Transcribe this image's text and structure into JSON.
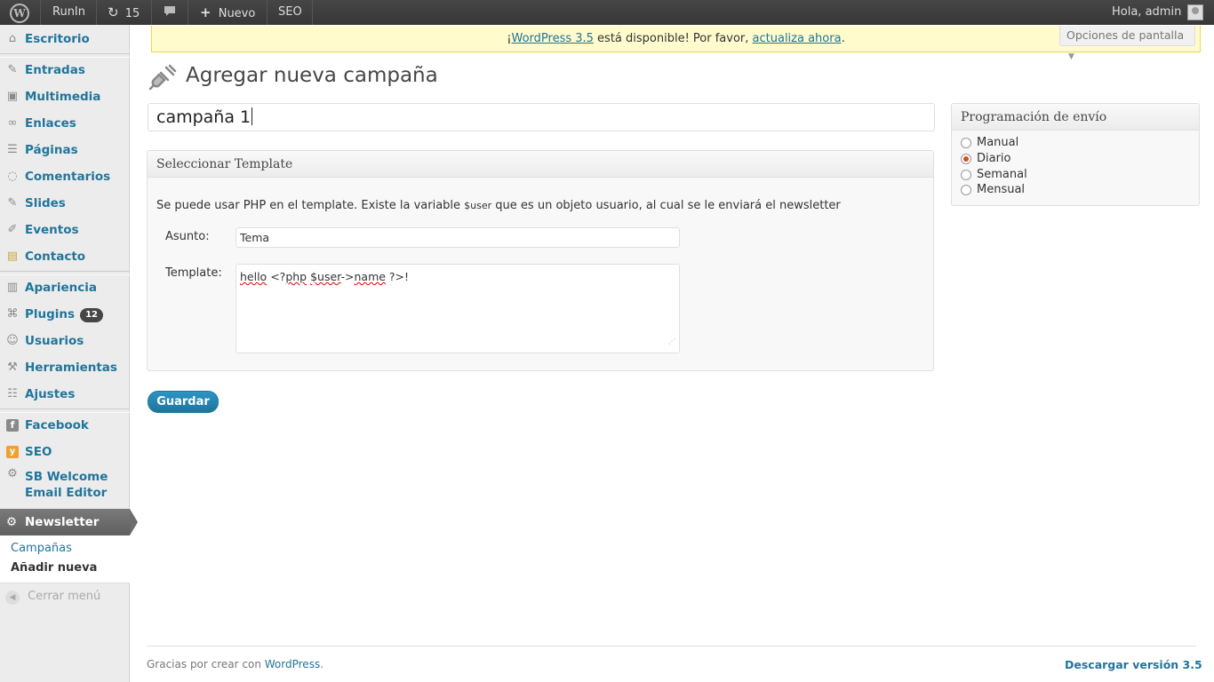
{
  "adminbar": {
    "site_name": "RunIn",
    "updates_count": "15",
    "new_label": "Nuevo",
    "seo_label": "SEO",
    "greeting": "Hola, admin"
  },
  "sidebar": {
    "items": [
      {
        "label": "Escritorio",
        "icon": "home-icon"
      },
      {
        "label": "Entradas",
        "icon": "pin-icon"
      },
      {
        "label": "Multimedia",
        "icon": "media-icon"
      },
      {
        "label": "Enlaces",
        "icon": "link-icon"
      },
      {
        "label": "Páginas",
        "icon": "pages-icon"
      },
      {
        "label": "Comentarios",
        "icon": "comment-icon"
      },
      {
        "label": "Slides",
        "icon": "pin-icon"
      },
      {
        "label": "Eventos",
        "icon": "events-icon"
      },
      {
        "label": "Contacto",
        "icon": "contact-icon"
      },
      {
        "label": "Apariencia",
        "icon": "appearance-icon"
      },
      {
        "label": "Plugins",
        "icon": "plugin-icon",
        "badge": "12"
      },
      {
        "label": "Usuarios",
        "icon": "users-icon"
      },
      {
        "label": "Herramientas",
        "icon": "tools-icon"
      },
      {
        "label": "Ajustes",
        "icon": "settings-icon"
      },
      {
        "label": "Facebook",
        "icon": "facebook-icon"
      },
      {
        "label": "SEO",
        "icon": "seo-icon"
      },
      {
        "label": "SB Welcome",
        "label2": "Email Editor",
        "icon": "gear-icon"
      },
      {
        "label": "Newsletter",
        "icon": "gear-icon"
      }
    ],
    "submenu": [
      "Campañas",
      "Añadir nueva"
    ],
    "collapse_label": "Cerrar menú"
  },
  "notice": {
    "prefix": "¡",
    "link1": "WordPress 3.5",
    "middle": " está disponible! Por favor, ",
    "link2": "actualiza ahora",
    "suffix": "."
  },
  "screen_options_label": "Opciones de pantalla",
  "page_title": "Agregar nueva campaña",
  "campaign_title_value": "campaña 1",
  "template_box": {
    "title": "Seleccionar Template",
    "description_before": "Se puede usar PHP en el template. Existe la variable ",
    "description_code": "$user",
    "description_after": " que es un objeto usuario, al cual se le enviará el newsletter",
    "subject_label": "Asunto:",
    "subject_value": "Tema",
    "template_label": "Template:",
    "template_parts": [
      "hello",
      " <?",
      "php",
      " ",
      "$user",
      "->",
      "name",
      " ?>!"
    ]
  },
  "schedule_box": {
    "title": "Programación de envío",
    "options": [
      "Manual",
      "Diario",
      "Semanal",
      "Mensual"
    ],
    "selected": "Diario"
  },
  "save_label": "Guardar",
  "footer": {
    "thanks": "Gracias por crear con ",
    "wp_link": "WordPress",
    "period": ".",
    "download": "Descargar versión 3.5"
  },
  "colors": {
    "link": "#21759b",
    "notice_bg": "#fffbcc",
    "adminbar_bg": "#464646",
    "radio_selected": "#d54e21"
  }
}
